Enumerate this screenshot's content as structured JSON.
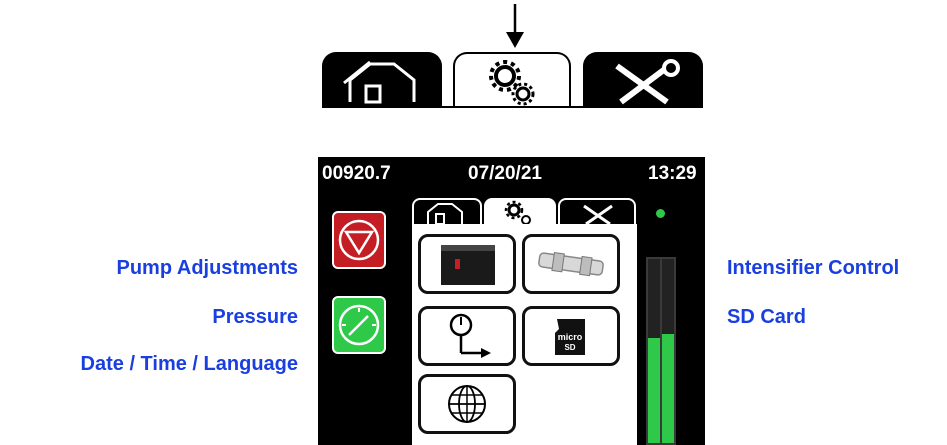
{
  "status_bar": {
    "counter": "00920.7",
    "date": "07/20/21",
    "time": "13:29"
  },
  "tabs": [
    {
      "name": "home",
      "icon": "house-icon",
      "selected": false
    },
    {
      "name": "settings",
      "icon": "gears-icon",
      "selected": true
    },
    {
      "name": "tools",
      "icon": "wrench-screwdriver-icon",
      "selected": false
    }
  ],
  "annotations": {
    "pump_adjustments": "Pump Adjustments",
    "pressure": "Pressure",
    "date_time_language": "Date / Time / Language",
    "intensifier_control": "Intensifier Control",
    "sd_card": "SD Card"
  },
  "menu_buttons": [
    {
      "name": "pump-adjustments",
      "icon": "pump-icon"
    },
    {
      "name": "intensifier-control",
      "icon": "intensifier-icon"
    },
    {
      "name": "pressure",
      "icon": "pressure-gauge-icon"
    },
    {
      "name": "sd-card",
      "icon": "micro-sd-icon"
    },
    {
      "name": "date-time-language",
      "icon": "globe-icon"
    }
  ],
  "side_buttons": [
    {
      "name": "stop",
      "icon": "stop-icon",
      "color": "#c41e24"
    },
    {
      "name": "gauge",
      "icon": "gauge-icon",
      "color": "#2fc94a"
    }
  ],
  "sd_label": "micro SD",
  "colors": {
    "annotation": "#1a3fe0",
    "meter_fill": "#2fc94a",
    "status_led": "#2fc94a"
  },
  "meter": {
    "left_level": 0.57,
    "right_level": 0.59
  }
}
